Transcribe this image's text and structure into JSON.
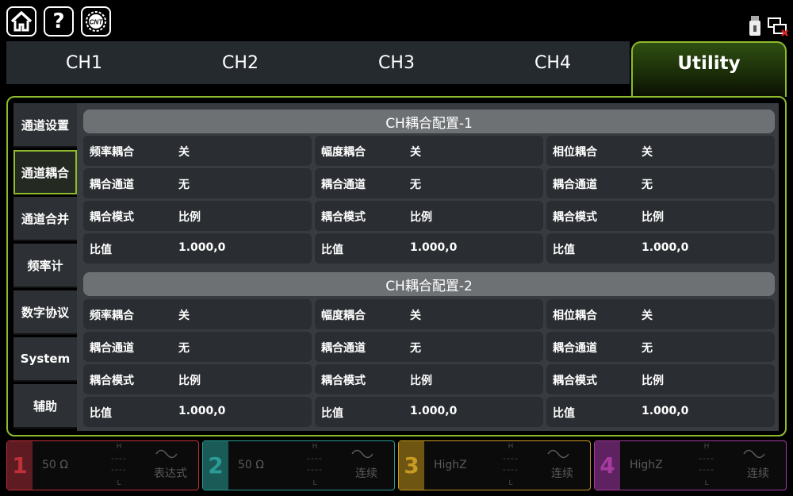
{
  "topbar": {
    "help_label": "?",
    "cnt_label": "CNT"
  },
  "tabs": [
    {
      "label": "CH1"
    },
    {
      "label": "CH2"
    },
    {
      "label": "CH3"
    },
    {
      "label": "CH4"
    },
    {
      "label": "Utility",
      "active": true
    }
  ],
  "sidebar": {
    "items": [
      {
        "label": "通道设置"
      },
      {
        "label": "通道耦合",
        "active": true
      },
      {
        "label": "通道合并"
      },
      {
        "label": "频率计"
      },
      {
        "label": "数字协议"
      },
      {
        "label": "System"
      },
      {
        "label": "辅助"
      }
    ]
  },
  "sections": [
    {
      "title": "CH耦合配置-1",
      "rows": [
        [
          {
            "label": "频率耦合",
            "value": "关"
          },
          {
            "label": "幅度耦合",
            "value": "关"
          },
          {
            "label": "相位耦合",
            "value": "关"
          }
        ],
        [
          {
            "label": "耦合通道",
            "value": "无"
          },
          {
            "label": "耦合通道",
            "value": "无"
          },
          {
            "label": "耦合通道",
            "value": "无"
          }
        ],
        [
          {
            "label": "耦合模式",
            "value": "比例"
          },
          {
            "label": "耦合模式",
            "value": "比例"
          },
          {
            "label": "耦合模式",
            "value": "比例"
          }
        ],
        [
          {
            "label": "比值",
            "value": "1.000,0"
          },
          {
            "label": "比值",
            "value": "1.000,0"
          },
          {
            "label": "比值",
            "value": "1.000,0"
          }
        ]
      ]
    },
    {
      "title": "CH耦合配置-2",
      "rows": [
        [
          {
            "label": "频率耦合",
            "value": "关"
          },
          {
            "label": "幅度耦合",
            "value": "关"
          },
          {
            "label": "相位耦合",
            "value": "关"
          }
        ],
        [
          {
            "label": "耦合通道",
            "value": "无"
          },
          {
            "label": "耦合通道",
            "value": "无"
          },
          {
            "label": "耦合通道",
            "value": "无"
          }
        ],
        [
          {
            "label": "耦合模式",
            "value": "比例"
          },
          {
            "label": "耦合模式",
            "value": "比例"
          },
          {
            "label": "耦合模式",
            "value": "比例"
          }
        ],
        [
          {
            "label": "比值",
            "value": "1.000,0"
          },
          {
            "label": "比值",
            "value": "1.000,0"
          },
          {
            "label": "比值",
            "value": "1.000,0"
          }
        ]
      ]
    }
  ],
  "channels": [
    {
      "num": "1",
      "impedance": "50 Ω",
      "high": "H",
      "low": "L",
      "dash1": "----",
      "dash2": "----",
      "mode": "表达式",
      "color": "#c0303a",
      "num_color": "#5e1c22"
    },
    {
      "num": "2",
      "impedance": "50 Ω",
      "high": "H",
      "low": "L",
      "dash1": "----",
      "dash2": "----",
      "mode": "连续",
      "color": "#2a9b95",
      "num_color": "#1a5a57"
    },
    {
      "num": "3",
      "impedance": "HighZ",
      "high": "H",
      "low": "L",
      "dash1": "----",
      "dash2": "----",
      "mode": "连续",
      "color": "#c79a22",
      "num_color": "#6e5512"
    },
    {
      "num": "4",
      "impedance": "HighZ",
      "high": "H",
      "low": "L",
      "dash1": "----",
      "dash2": "----",
      "mode": "连续",
      "color": "#a43ba0",
      "num_color": "#5e2260"
    }
  ],
  "colors": {
    "accent": "#8dbb2b",
    "panel": "#383b3f",
    "cell": "#2a2d31",
    "section_header": "#6e7174"
  }
}
